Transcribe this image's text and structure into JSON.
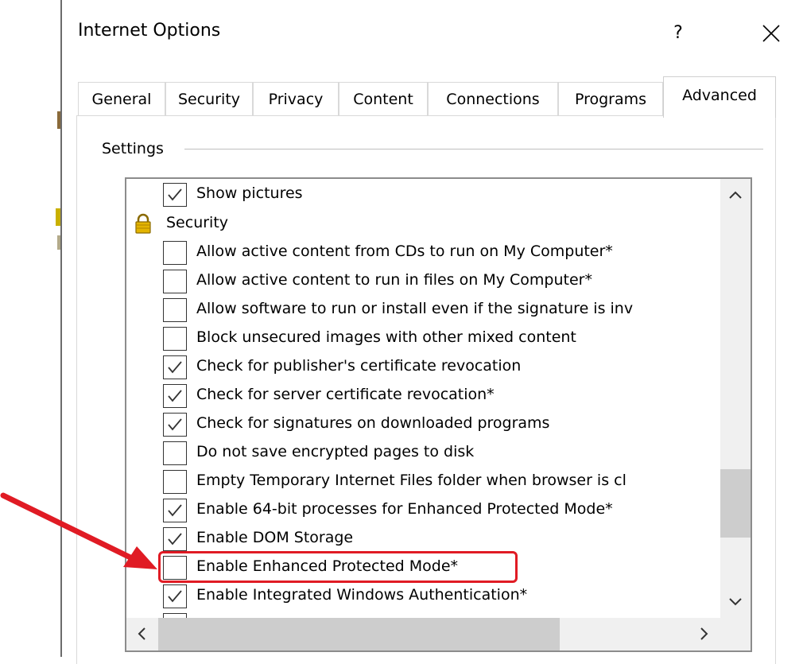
{
  "window": {
    "title": "Internet Options",
    "help_label": "?"
  },
  "tabs": [
    {
      "label": "General"
    },
    {
      "label": "Security"
    },
    {
      "label": "Privacy"
    },
    {
      "label": "Content"
    },
    {
      "label": "Connections"
    },
    {
      "label": "Programs"
    },
    {
      "label": "Advanced",
      "active": true
    }
  ],
  "settings": {
    "group_label": "Settings",
    "items": [
      {
        "label": "Show pictures",
        "checked": true
      },
      {
        "label": "Security",
        "heading": true,
        "icon": "lock-icon"
      },
      {
        "label": "Allow active content from CDs to run on My Computer*",
        "checked": false
      },
      {
        "label": "Allow active content to run in files on My Computer*",
        "checked": false
      },
      {
        "label": "Allow software to run or install even if the signature is inv",
        "checked": false
      },
      {
        "label": "Block unsecured images with other mixed content",
        "checked": false
      },
      {
        "label": "Check for publisher's certificate revocation",
        "checked": true
      },
      {
        "label": "Check for server certificate revocation*",
        "checked": true
      },
      {
        "label": "Check for signatures on downloaded programs",
        "checked": true
      },
      {
        "label": "Do not save encrypted pages to disk",
        "checked": false
      },
      {
        "label": "Empty Temporary Internet Files folder when browser is cl",
        "checked": false
      },
      {
        "label": "Enable 64-bit processes for Enhanced Protected Mode*",
        "checked": true
      },
      {
        "label": "Enable DOM Storage",
        "checked": true
      },
      {
        "label": "Enable Enhanced Protected Mode*",
        "checked": false,
        "highlighted": true
      },
      {
        "label": "Enable Integrated Windows Authentication*",
        "checked": true
      }
    ]
  },
  "annotation": {
    "color": "#e01b24"
  }
}
